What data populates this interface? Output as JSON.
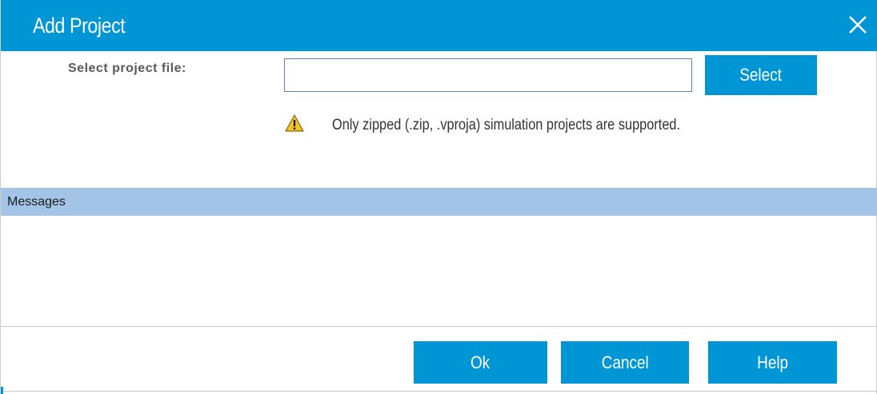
{
  "dialog": {
    "title": "Add Project",
    "close_icon": "close-icon"
  },
  "file_select": {
    "label": "Select project file:",
    "input_value": "",
    "input_placeholder": "",
    "select_button_label": "Select"
  },
  "notice": {
    "icon": "warning-icon",
    "text": "Only zipped (.zip, .vproja) simulation projects are supported."
  },
  "messages": {
    "header": "Messages"
  },
  "footer": {
    "ok_label": "Ok",
    "cancel_label": "Cancel",
    "help_label": "Help"
  },
  "colors": {
    "accent": "#0096d6",
    "messages_header": "#a3c4e6",
    "warning": "#f2c230"
  }
}
